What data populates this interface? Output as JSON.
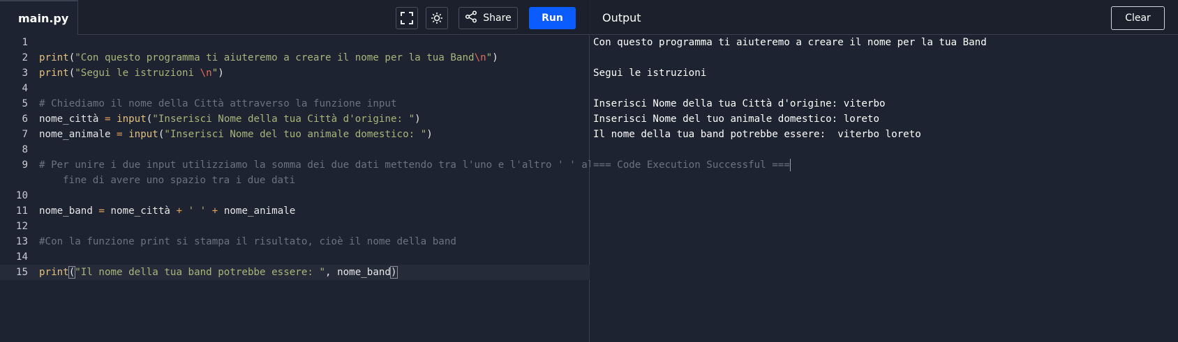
{
  "editor": {
    "tab_label": "main.py",
    "share_label": "Share",
    "run_label": "Run",
    "lines": [
      {
        "n": "1"
      },
      {
        "n": "2",
        "p": [
          "print",
          "(",
          "\"Con questo programma ti aiuteremo a creare il nome per la tua Band",
          "\\n",
          "\"",
          ")"
        ]
      },
      {
        "n": "3",
        "p": [
          "print",
          "(",
          "\"Segui le istruzioni ",
          "\\n",
          "\"",
          ")"
        ]
      },
      {
        "n": "4"
      },
      {
        "n": "5",
        "p": [
          "# Chiediamo il nome della Città attraverso la funzione input"
        ]
      },
      {
        "n": "6",
        "p": [
          "nome_città ",
          "=",
          " ",
          "input",
          "(",
          "\"Inserisci Nome della tua Città d'origine: \"",
          ")"
        ]
      },
      {
        "n": "7",
        "p": [
          "nome_animale ",
          "=",
          " ",
          "input",
          "(",
          "\"Inserisci Nome del tuo animale domestico: \"",
          ")"
        ]
      },
      {
        "n": "8"
      },
      {
        "n": "9",
        "p": [
          "# Per unire i due input utilizziamo la somma dei due dati mettendo tra l'uno e l'altro ' ' al"
        ],
        "wrap": "fine di avere uno spazio tra i due dati"
      },
      {
        "n": "10"
      },
      {
        "n": "11",
        "p": [
          "nome_band ",
          "=",
          " nome_città ",
          "+",
          " ",
          "' '",
          " ",
          "+",
          " nome_animale"
        ]
      },
      {
        "n": "12"
      },
      {
        "n": "13",
        "p": [
          "#Con la funzione print si stampa il risultato, cioè il nome della band"
        ]
      },
      {
        "n": "14"
      },
      {
        "n": "15",
        "p": [
          "print",
          "(",
          "\"Il nome della tua band potrebbe essere: \"",
          ", nome_band",
          ")"
        ]
      }
    ]
  },
  "output": {
    "title": "Output",
    "clear_label": "Clear",
    "lines": [
      "Con questo programma ti aiuteremo a creare il nome per la tua Band",
      "",
      "Segui le istruzioni",
      "",
      "Inserisci Nome della tua Città d'origine: viterbo",
      "Inserisci Nome del tuo animale domestico: loreto",
      "Il nome della tua band potrebbe essere:  viterbo loreto",
      "",
      "=== Code Execution Successful ==="
    ]
  },
  "icons": {
    "fullscreen": "fullscreen-icon",
    "theme": "sun-icon",
    "share": "share-icon"
  },
  "colors": {
    "run_button": "#0a5cff",
    "keyword": "#e5c07b",
    "string": "#a8b57a",
    "comment": "#6b7280",
    "escape": "#e06c5a"
  }
}
